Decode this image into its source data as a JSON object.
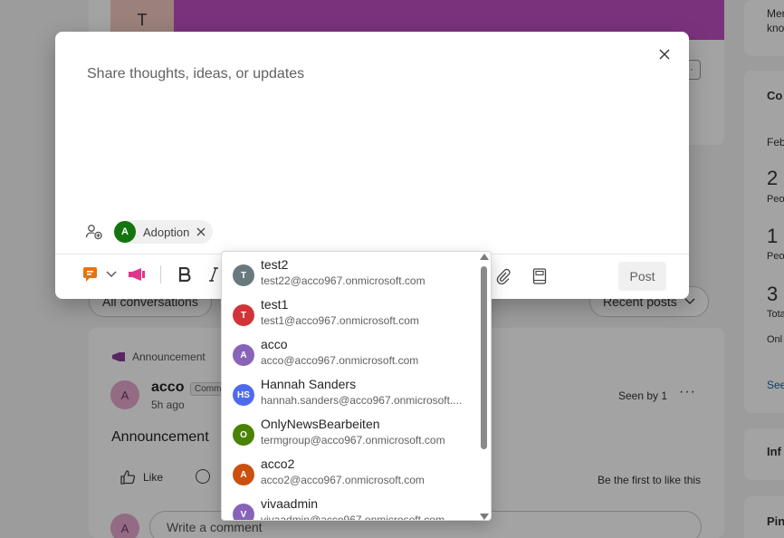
{
  "background": {
    "hero": {
      "avatar_letter": "T",
      "more_label": "···"
    },
    "filters": {
      "left_label": "All conversations",
      "right_label": "Recent posts"
    },
    "post": {
      "tag": "Announcement",
      "avatar_letter": "A",
      "author": "acco",
      "role_chip": "Comm",
      "time": "5h ago",
      "seen_by": "Seen by 1",
      "more_label": "···",
      "text": "Announcement",
      "like_label": "Like",
      "first_like": "Be the first to like this",
      "comment_placeholder": "Write a comment"
    },
    "sidebar": {
      "card1_line1": "Mer",
      "card1_line2": "kno",
      "card2_title": "Co",
      "card2_month": "Feb",
      "stat1_value": "2",
      "stat1_label": "Peo",
      "stat2_value": "1",
      "stat2_label": "Peo",
      "stat3_value": "3",
      "stat3_label": "Tota",
      "only_label": "Onl",
      "see_link": "See",
      "card3_title": "Inf",
      "card4_title": "Pin"
    }
  },
  "modal": {
    "composer_placeholder": "Share thoughts, ideas, or updates",
    "community_chip": {
      "avatar_letter": "A",
      "label": "Adoption"
    },
    "post_button": "Post"
  },
  "mention_list": [
    {
      "initials": "T",
      "name": "test2",
      "email": "test22@acco967.onmicrosoft.com",
      "color": "#69797e"
    },
    {
      "initials": "T",
      "name": "test1",
      "email": "test1@acco967.onmicrosoft.com",
      "color": "#d13438"
    },
    {
      "initials": "A",
      "name": "acco",
      "email": "acco@acco967.onmicrosoft.com",
      "color": "#8764b8"
    },
    {
      "initials": "HS",
      "name": "Hannah Sanders",
      "email": "hannah.sanders@acco967.onmicrosoft....",
      "color": "#4f6bed"
    },
    {
      "initials": "O",
      "name": "OnlyNewsBearbeiten",
      "email": "termgroup@acco967.onmicrosoft.com",
      "color": "#498205"
    },
    {
      "initials": "A",
      "name": "acco2",
      "email": "acco2@acco967.onmicrosoft.com",
      "color": "#ca5010"
    },
    {
      "initials": "V",
      "name": "vivaadmin",
      "email": "vivaadmin@acco967.onmicrosoft.com",
      "color": "#8764b8"
    }
  ],
  "colors": {
    "praise_orange": "#e8730c",
    "announcement_pink": "#e0368c",
    "community_green": "#13750e"
  },
  "icons": {
    "close": "close-icon",
    "audience": "add-people-icon",
    "praise": "praise-icon",
    "announcement": "megaphone-icon",
    "bold": "bold-icon",
    "italic": "italic-icon",
    "attach": "paperclip-icon",
    "notebook": "notebook-icon"
  }
}
